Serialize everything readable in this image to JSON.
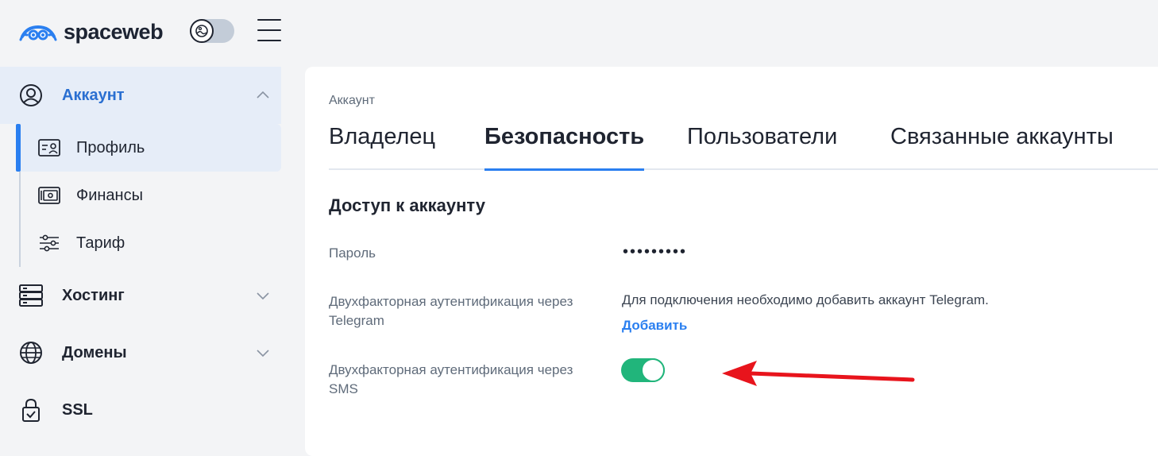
{
  "brand": {
    "name": "spaceweb"
  },
  "sidebar": {
    "account": {
      "label": "Аккаунт",
      "icon": "user-circle-icon"
    },
    "sub_items": [
      {
        "label": "Профиль",
        "icon": "id-card-icon",
        "active": true
      },
      {
        "label": "Финансы",
        "icon": "wallet-icon",
        "active": false
      },
      {
        "label": "Тариф",
        "icon": "sliders-icon",
        "active": false
      }
    ],
    "items": [
      {
        "label": "Хостинг",
        "icon": "server-icon"
      },
      {
        "label": "Домены",
        "icon": "globe-icon"
      },
      {
        "label": "SSL",
        "icon": "lock-icon"
      }
    ]
  },
  "main": {
    "breadcrumb": "Аккаунт",
    "tabs": [
      {
        "label": "Владелец",
        "active": false
      },
      {
        "label": "Безопасность",
        "active": true
      },
      {
        "label": "Пользователи",
        "active": false
      },
      {
        "label": "Связанные аккаунты",
        "active": false
      }
    ],
    "section_title": "Доступ к аккаунту",
    "rows": {
      "password": {
        "label": "Пароль",
        "value": "•••••••••"
      },
      "telegram": {
        "label": "Двухфакторная аутентификация через Telegram",
        "note": "Для подключения необходимо добавить аккаунт Telegram.",
        "action": "Добавить"
      },
      "sms": {
        "label": "Двухфакторная аутентификация через SMS",
        "enabled": true
      }
    }
  },
  "colors": {
    "accent": "#2a7ff0",
    "toggle_on": "#21b57b",
    "annotation_arrow": "#e8141c",
    "active_bg": "#e6edf8"
  }
}
